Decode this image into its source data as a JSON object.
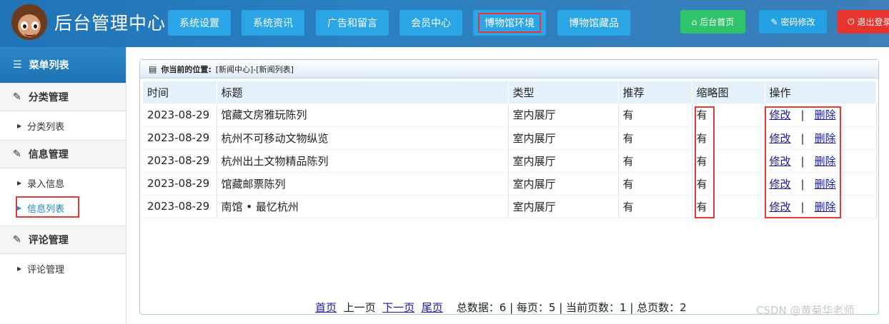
{
  "header": {
    "title": "后台管理中心",
    "nav": [
      "系统设置",
      "系统资讯",
      "广告和留言",
      "会员中心",
      "博物馆环境",
      "博物馆藏品"
    ],
    "active_nav": 4,
    "home_label": "后台首页",
    "password_label": "密码修改",
    "logout_label": "退出登录"
  },
  "sidebar": {
    "title": "菜单列表",
    "groups": [
      {
        "label": "分类管理",
        "items": [
          "分类列表"
        ]
      },
      {
        "label": "信息管理",
        "items": [
          "录入信息",
          "信息列表"
        ]
      },
      {
        "label": "评论管理",
        "items": [
          "评论管理"
        ]
      }
    ],
    "active_item": "信息列表"
  },
  "breadcrumb": {
    "label": "你当前的位置:",
    "path": "[新闻中心]-[新闻列表]"
  },
  "table": {
    "headers": [
      "时间",
      "标题",
      "类型",
      "推荐",
      "缩略图",
      "操作"
    ],
    "rows": [
      {
        "date": "2023-08-29",
        "title": "馆藏文房雅玩陈列",
        "type": "室内展厅",
        "rec": "有",
        "thumb": "有"
      },
      {
        "date": "2023-08-29",
        "title": "杭州不可移动文物纵览",
        "type": "室内展厅",
        "rec": "有",
        "thumb": "有"
      },
      {
        "date": "2023-08-29",
        "title": "杭州出土文物精品陈列",
        "type": "室内展厅",
        "rec": "有",
        "thumb": "有"
      },
      {
        "date": "2023-08-29",
        "title": "馆藏邮票陈列",
        "type": "室内展厅",
        "rec": "有",
        "thumb": "有"
      },
      {
        "date": "2023-08-29",
        "title": "南馆 • 最忆杭州",
        "type": "室内展厅",
        "rec": "有",
        "thumb": "有"
      }
    ],
    "edit_label": "修改",
    "separator": "|",
    "delete_label": "删除"
  },
  "pager": {
    "first": "首页",
    "prev": "上一页",
    "next": "下一页",
    "last": "尾页",
    "summary": "总数据：6 | 每页：5 | 当前页数：1 | 总页数：2"
  },
  "watermark": "CSDN @黄菊华老师",
  "colors": {
    "header_bg": "#2b7fc1",
    "nav_button": "#2aa6e6",
    "home_green": "#2fc36b",
    "password_blue": "#23a1e3",
    "logout_red": "#e8342f",
    "highlight_red": "#e53935",
    "link": "#1a1aa8"
  }
}
